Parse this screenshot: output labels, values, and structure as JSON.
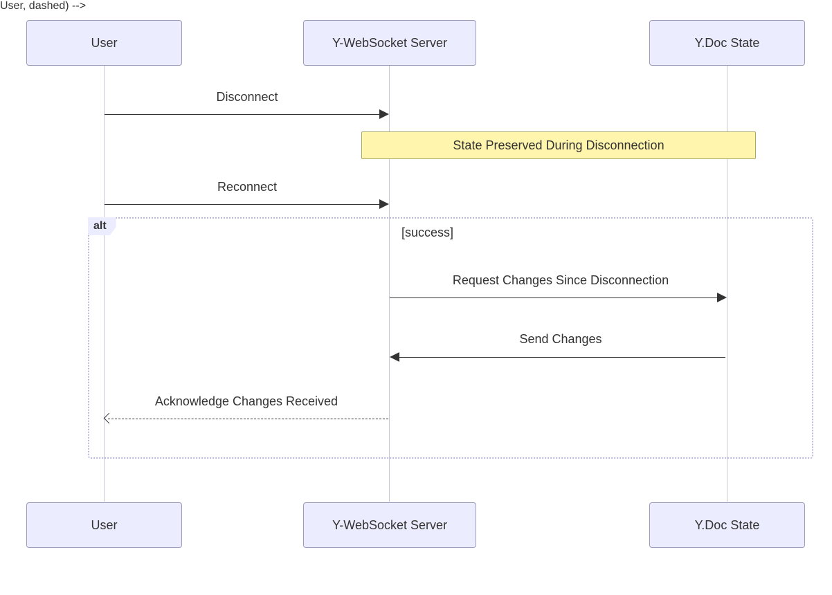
{
  "diagram_type": "sequence",
  "actors": {
    "user": "User",
    "server": "Y-WebSocket Server",
    "ydoc": "Y.Doc State"
  },
  "messages": {
    "m1": "Disconnect",
    "m2": "Reconnect",
    "m3": "Request Changes Since Disconnection",
    "m4": "Send Changes",
    "m5": "Acknowledge Changes Received"
  },
  "note": "State Preserved During Disconnection",
  "alt": {
    "label": "alt",
    "condition": "[success]"
  },
  "colors": {
    "actor_fill": "#ececff",
    "actor_border": "#9b9bba",
    "note_fill": "#fff5ad",
    "note_border": "#a9a96a",
    "alt_border": "#b9b9e2"
  }
}
